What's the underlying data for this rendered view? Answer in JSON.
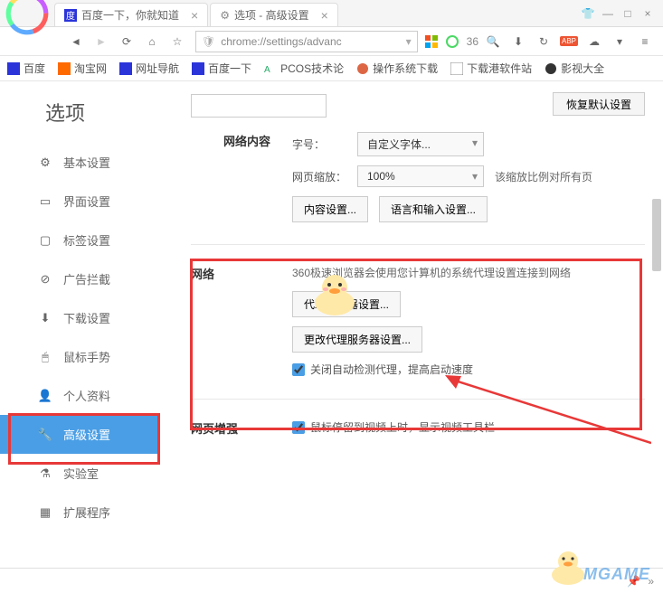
{
  "tabs": [
    {
      "label": "百度一下，你就知道"
    },
    {
      "label": "选项 - 高级设置"
    }
  ],
  "url": "chrome://settings/advanc",
  "search_count": "36",
  "bookmarks": [
    {
      "label": "百度"
    },
    {
      "label": "淘宝网"
    },
    {
      "label": "网址导航"
    },
    {
      "label": "百度一下"
    },
    {
      "label": "PCOS技术论"
    },
    {
      "label": "操作系统下载"
    },
    {
      "label": "下载港软件站"
    },
    {
      "label": "影视大全"
    }
  ],
  "sidebar": {
    "title": "选项",
    "items": [
      {
        "label": "基本设置"
      },
      {
        "label": "界面设置"
      },
      {
        "label": "标签设置"
      },
      {
        "label": "广告拦截"
      },
      {
        "label": "下载设置"
      },
      {
        "label": "鼠标手势"
      },
      {
        "label": "个人资料"
      },
      {
        "label": "高级设置"
      },
      {
        "label": "实验室"
      },
      {
        "label": "扩展程序"
      }
    ]
  },
  "restore_btn": "恢复默认设置",
  "sections": {
    "netcontent": {
      "title": "网络内容",
      "font_label": "字号：",
      "font_value": "自定义字体...",
      "zoom_label": "网页缩放：",
      "zoom_value": "100%",
      "zoom_desc": "该缩放比例对所有页",
      "content_btn": "内容设置...",
      "lang_btn": "语言和输入设置..."
    },
    "network": {
      "title": "网络",
      "desc": "360极速浏览器会使用您计算机的系统代理设置连接到网络",
      "proxy_btn": "代理服务器设置...",
      "change_proxy_btn": "更改代理服务器设置...",
      "checkbox_label": "关闭自动检测代理，提高启动速度"
    },
    "enhance": {
      "title": "网页增强",
      "checkbox_label": "鼠标停留到视频上时，显示视频工具栏"
    }
  },
  "watermark": "3DMGAME"
}
